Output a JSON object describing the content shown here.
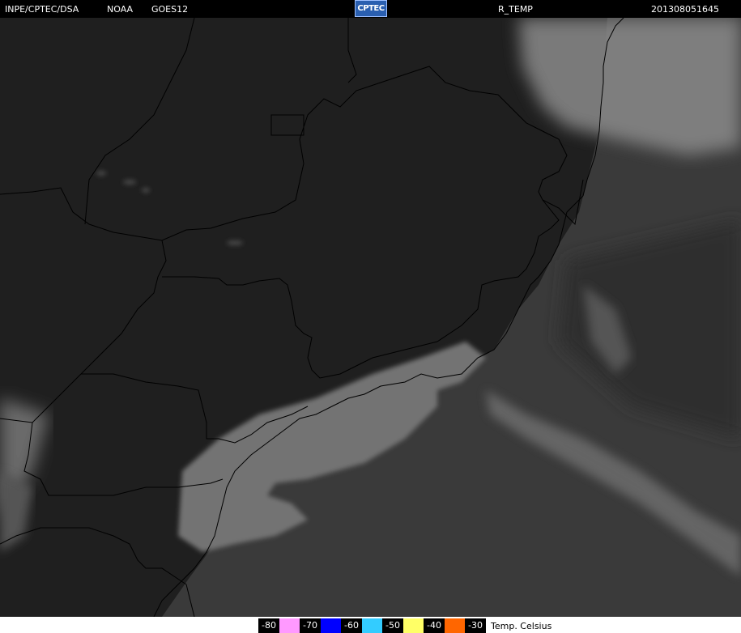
{
  "header": {
    "source": "INPE/CPTEC/DSA",
    "agency": "NOAA",
    "satellite": "GOES12",
    "logo_text": "CPTEC",
    "product": "R_TEMP",
    "timestamp": "201308051645"
  },
  "legend": {
    "items": [
      {
        "label": "-80",
        "color": "#ff99ff"
      },
      {
        "label": "-70",
        "color": "#0000ff"
      },
      {
        "label": "-60",
        "color": "#33ccff"
      },
      {
        "label": "-50",
        "color": "#ffff66"
      },
      {
        "label": "-40",
        "color": "#ff6600"
      },
      {
        "label": "-30",
        "color": ""
      }
    ],
    "unit": "Temp. Celsius"
  },
  "colors": {
    "land": "#1e1e1e",
    "ocean": "#3a3a3a",
    "fog": "#7a7a7a",
    "cloud": "#9a9a9a",
    "borders": "#000000"
  }
}
